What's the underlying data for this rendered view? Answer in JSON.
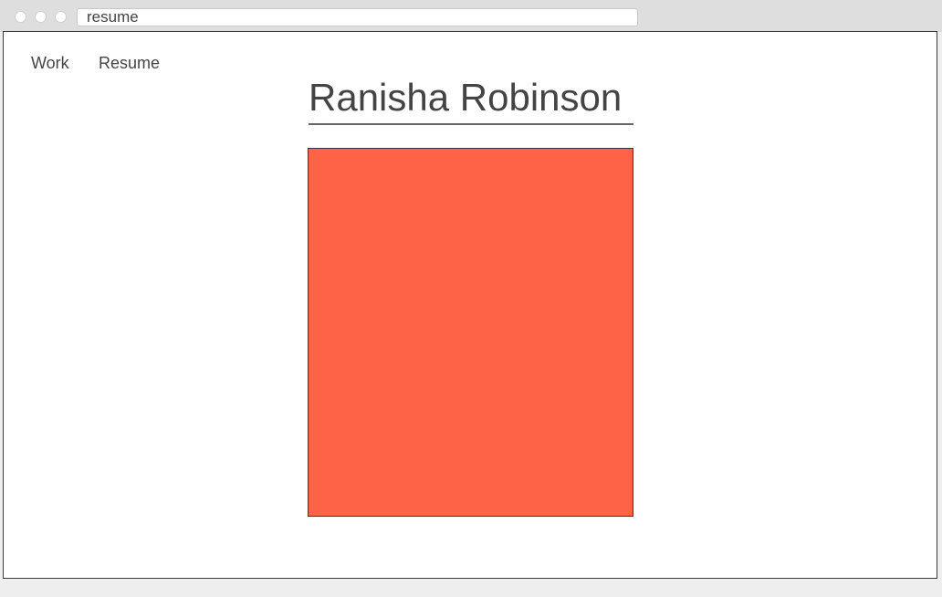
{
  "browser": {
    "url_text": "resume"
  },
  "nav": {
    "items": [
      {
        "label": "Work"
      },
      {
        "label": "Resume"
      }
    ]
  },
  "header": {
    "title": "Ranisha Robinson"
  },
  "colors": {
    "accent_block": "#ff6347"
  }
}
